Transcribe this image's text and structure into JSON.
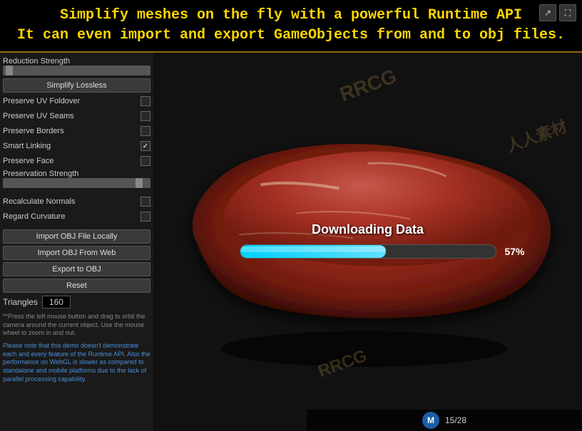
{
  "header": {
    "line1": "Simplify meshes on the fly with a powerful Runtime API",
    "line2": "It can even import and export GameObjects from and to obj files."
  },
  "top_icons": [
    {
      "name": "share-icon",
      "symbol": "↗"
    },
    {
      "name": "fullscreen-icon",
      "symbol": "⛶"
    }
  ],
  "left_panel": {
    "reduction_strength_label": "Reduction Strength",
    "simplify_lossless_btn": "Simplify Lossless",
    "checkboxes": [
      {
        "id": "preserve-uv-foldover",
        "label": "Preserve UV Foldover",
        "checked": false
      },
      {
        "id": "preserve-uv-seams",
        "label": "Preserve UV Seams",
        "checked": false
      },
      {
        "id": "preserve-borders",
        "label": "Preserve Borders",
        "checked": false
      },
      {
        "id": "smart-linking",
        "label": "Smart Linking",
        "checked": true
      },
      {
        "id": "preserve-face",
        "label": "Preserve Face",
        "checked": false
      }
    ],
    "preservation_strength_label": "Preservation Strength",
    "recalculate_normals_label": "Recalculate Normals",
    "regard_curvature_label": "Regard Curvature",
    "buttons": [
      "Import OBJ File Locally",
      "Import OBJ From Web",
      "Export to OBJ",
      "Reset"
    ],
    "triangles_label": "Triangles",
    "triangles_value": "160",
    "info_text_1": "**Press the left mouse button and drag to orbit the camera around the current object. Use the mouse wheel to zoom in and out.",
    "info_text_2": "Please note that this demo doesn't demonstrate each and every feature of the Runtime API. Also the performance on WebGL is slower as compared to standalone and mobile platforms due to the lack of parallel processing capability."
  },
  "viewport": {
    "download_text": "Downloading Data",
    "progress_percent": 57,
    "progress_percent_label": "57%",
    "page_current": 15,
    "page_total": 28,
    "page_label": "15/28",
    "watermarks": [
      "RRCG",
      "人人素材",
      "RRCG"
    ]
  }
}
